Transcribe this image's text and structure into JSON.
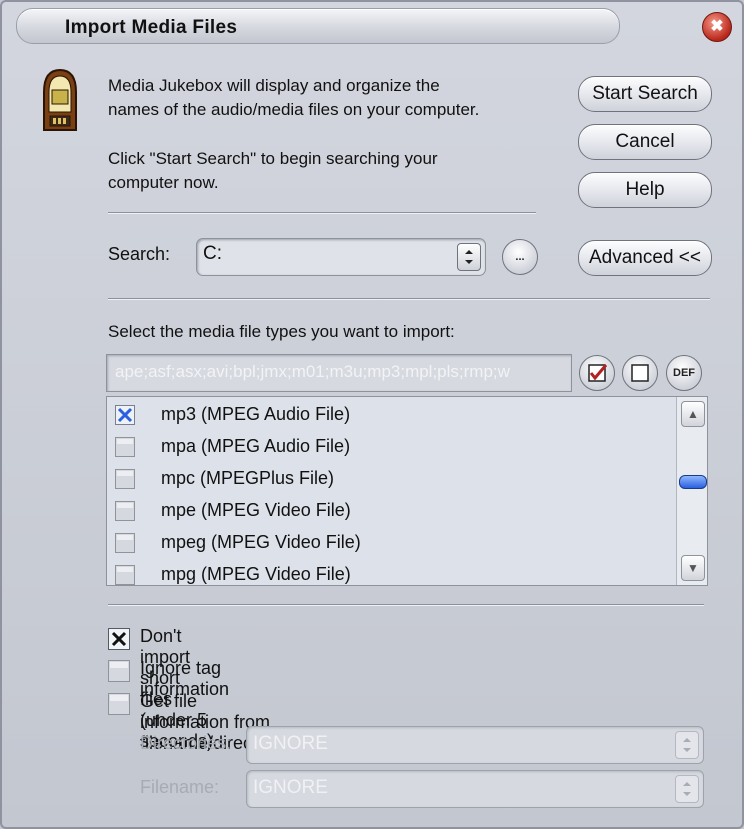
{
  "window": {
    "title": "Import Media Files",
    "close_glyph": "✖"
  },
  "intro": {
    "line1": "Media Jukebox will display and organize the",
    "line2": "names of the audio/media files on your computer.",
    "line3": "Click \"Start Search\" to begin searching your",
    "line4": "computer now."
  },
  "buttons": {
    "start_search": "Start Search",
    "cancel": "Cancel",
    "help": "Help",
    "advanced": "Advanced <<",
    "browse": "...",
    "check_all_icon": "check-all-icon",
    "uncheck_all_icon": "uncheck-all-icon",
    "defaults": "DEF"
  },
  "search": {
    "label": "Search:",
    "value": "C:"
  },
  "filetypes": {
    "label": "Select the media file types you want to import:",
    "extensions": "ape;asf;asx;avi;bpl;jmx;m01;m3u;mp3;mpl;pls;rmp;w",
    "items": [
      {
        "label": "mp3 (MPEG Audio File)",
        "checked": true
      },
      {
        "label": "mpa (MPEG Audio File)",
        "checked": false
      },
      {
        "label": "mpc (MPEGPlus File)",
        "checked": false
      },
      {
        "label": "mpe (MPEG Video File)",
        "checked": false
      },
      {
        "label": "mpeg (MPEG Video File)",
        "checked": false
      },
      {
        "label": "mpg (MPEG Video File)",
        "checked": false
      }
    ]
  },
  "options": {
    "short_files": {
      "label": "Don't import short files (under 5 seconds)",
      "checked": true
    },
    "ignore_tags": {
      "label": "Ignore tag information",
      "checked": false
    },
    "from_filename": {
      "label": "Get file information from filename/directory",
      "checked": false
    }
  },
  "directories": {
    "label": "Directories:",
    "value": "IGNORE"
  },
  "filename": {
    "label": "Filename:",
    "value": "IGNORE"
  },
  "colors": {
    "accent_blue": "#2a5fe0",
    "check_red": "#b22222"
  }
}
